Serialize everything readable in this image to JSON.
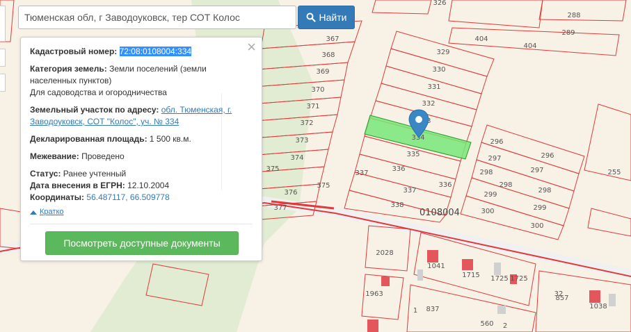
{
  "search": {
    "value": "Тюменская обл, г Заводоуковск, тер СОТ Колос",
    "button_label": "Найти",
    "button_icon": "search-icon"
  },
  "info_panel": {
    "cadastral_label": "Кадастровый номер:",
    "cadastral_value": "72:08:0108004:334",
    "category_label": "Категория земель:",
    "category_value": "Земли поселений (земли населенных пунктов)",
    "usage": "Для садоводства и огородничества",
    "address_label": "Земельный участок по адресу:",
    "address_value": "обл. Тюменская, г. Заводоуковск, СОТ \"Колос\", уч. № 334",
    "area_label": "Декларированная площадь:",
    "area_value": "1 500 кв.м.",
    "survey_label": "Межевание:",
    "survey_value": "Проведено",
    "status_label": "Статус:",
    "status_value": "Ранее учтенный",
    "egrn_label": "Дата внесения в ЕГРН:",
    "egrn_value": "12.10.2004",
    "coords_label": "Координаты:",
    "coords_value": "56.487117, 66.509778",
    "brief_label": "Кратко",
    "close_symbol": "×",
    "docs_button": "Посмотреть доступные документы"
  },
  "map": {
    "block_number": "0108004",
    "plots": [
      "326",
      "288",
      "289",
      "404",
      "404",
      "367",
      "368",
      "369",
      "370",
      "371",
      "372",
      "373",
      "374",
      "375",
      "375",
      "376",
      "377",
      "329",
      "330",
      "331",
      "332",
      "333",
      "334",
      "335",
      "336",
      "336",
      "337",
      "337",
      "338",
      "296",
      "296",
      "297",
      "297",
      "298",
      "298",
      "298",
      "299",
      "299",
      "300",
      "300",
      "255",
      "2028",
      "1963",
      "1041",
      "1715",
      "1725",
      "1725",
      "837",
      "1",
      "560",
      "2",
      "32",
      "857",
      "1038"
    ],
    "colors": {
      "background": "#f7f1e6",
      "boundary": "#e03a3a",
      "selected_fill": "#78e878",
      "green_area": "#e2ecd2",
      "building": "#e3565b",
      "marker": "#3b86c4"
    }
  }
}
